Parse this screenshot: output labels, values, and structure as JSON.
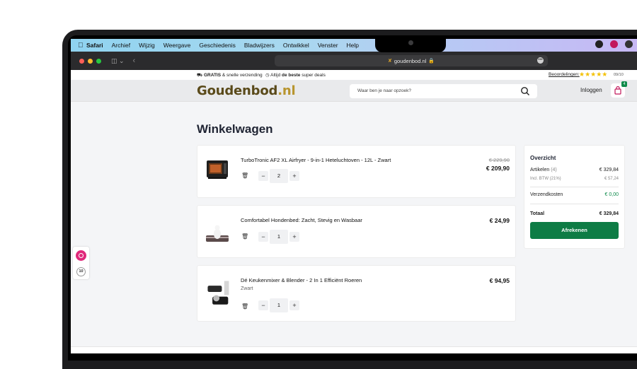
{
  "menubar": {
    "app": "Safari",
    "items": [
      "Archief",
      "Wijzig",
      "Weergave",
      "Geschiedenis",
      "Bladwijzers",
      "Ontwikkel",
      "Venster",
      "Help"
    ]
  },
  "browser": {
    "url": "goudenbod.nl"
  },
  "topbar": {
    "usp1_bold": "GRATIS",
    "usp1_rest": " & snelle verzending",
    "usp2_pre": "Altijd ",
    "usp2_bold": "de beste",
    "usp2_rest": " super deals",
    "reviews_label": "Beoordelingen:",
    "stars": "★★★★★",
    "score": "09/10"
  },
  "header": {
    "logo_main": "Goudenbod",
    "logo_ext": ".nl",
    "search_placeholder": "Waar ben je naar opzoek?",
    "login_label": "Inloggen",
    "cart_count": "4"
  },
  "page": {
    "title": "Winkelwagen"
  },
  "cart_items": [
    {
      "name": "TurboTronic AF2 XL Airfryer - 9-in-1 Heteluchtoven - 12L - Zwart",
      "variant": "",
      "old_price": "€ 229,90",
      "price": "€ 209,90",
      "qty": "2"
    },
    {
      "name": "Comfortabel Hondenbed: Zacht, Stevig en Wasbaar",
      "variant": "",
      "old_price": "",
      "price": "€ 24,99",
      "qty": "1"
    },
    {
      "name": "Dé Keukenmixer & Blender - 2 In 1 Efficiënt Roeren",
      "variant": "Zwart",
      "old_price": "",
      "price": "€ 94,95",
      "qty": "1"
    }
  ],
  "qty_controls": {
    "minus": "−",
    "plus": "+"
  },
  "summary": {
    "title": "Overzicht",
    "articles_label": "Artikelen",
    "articles_count": "(4)",
    "articles_value": "€ 329,84",
    "vat_label": "Incl. BTW (21%)",
    "vat_value": "€ 57,24",
    "shipping_label": "Verzendkosten",
    "shipping_value": "€ 0,00",
    "total_label": "Totaal",
    "total_value": "€ 329,84",
    "checkout_label": "Afrekenen"
  },
  "floating": {
    "badge_text": "10"
  },
  "colors": {
    "accent_green": "#0e7c45",
    "logo_gold": "#b8952f",
    "star": "#f3c000"
  }
}
